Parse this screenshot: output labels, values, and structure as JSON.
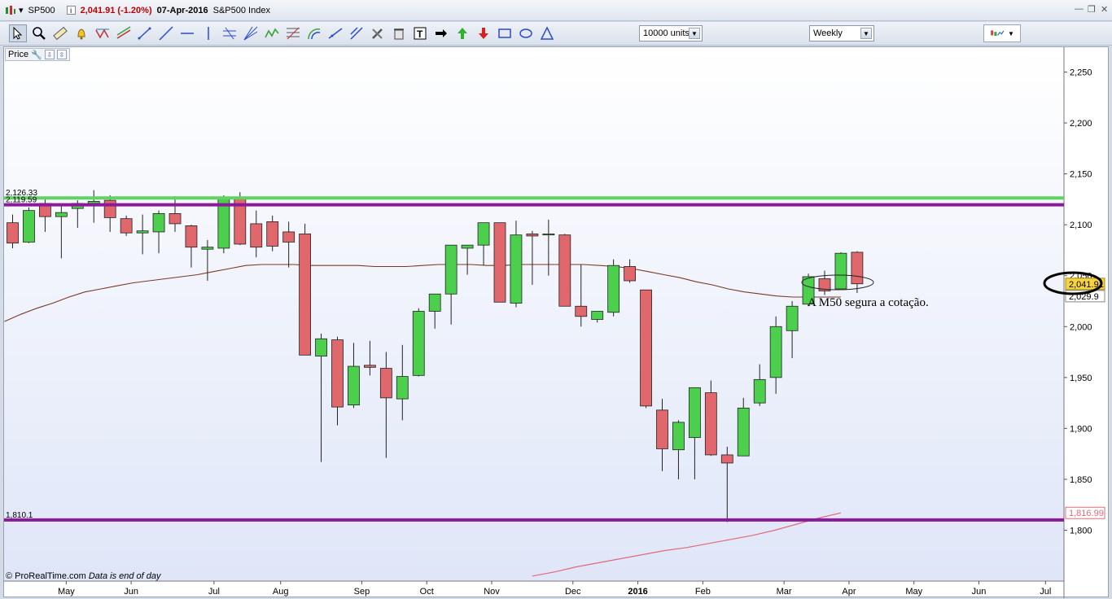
{
  "window": {
    "symbol": "SP500",
    "info_icon": "info-icon",
    "last_change": "2,041.91 (-1.20%)",
    "date": "07-Apr-2016",
    "instrument": "S&P500 Index"
  },
  "toolbar": {
    "units_select": "10000 units",
    "period_select": "Weekly",
    "icons": [
      "pointer-icon",
      "zoom-icon",
      "ruler-icon",
      "alert-bell-icon",
      "triangle-pattern-icon",
      "channel-icon",
      "segment-icon",
      "line-icon",
      "horizontal-line-icon",
      "vertical-line-icon",
      "parallel-lines-icon",
      "fan-icon",
      "zigzag-icon",
      "fibonacci-icon",
      "arc-icon",
      "ray-icon",
      "trend-icon",
      "tools-icon",
      "trash-icon",
      "text-icon",
      "arrow-right-icon",
      "arrow-up-green-icon",
      "arrow-down-red-icon",
      "rectangle-icon",
      "ellipse-icon",
      "triangle-icon"
    ]
  },
  "price_panel": {
    "label": "Price"
  },
  "footer": {
    "copyright": "© ProRealTime.com",
    "note": "Data is end of day"
  },
  "colors": {
    "up": "#4ccf4c",
    "down": "#e0676c",
    "resistance_green": "#5fd45f",
    "resistance_purple": "#8b1a9a",
    "support_purple": "#8b1a9a",
    "ma50": "#7a3a28",
    "ma_long": "#e06a7a",
    "last_price_bg": "#f5d442"
  },
  "chart_data": {
    "type": "candlestick",
    "timeframe": "weekly",
    "ylim": [
      1750,
      2280
    ],
    "y_ticks": [
      "2,250",
      "2,200",
      "2,150",
      "2,100",
      "2,050",
      "2,000",
      "1,950",
      "1,900",
      "1,850",
      "1,800"
    ],
    "x_tick_labels": [
      "May",
      "Jun",
      "Jul",
      "Aug",
      "Sep",
      "Oct",
      "Nov",
      "Dec",
      "2016",
      "Feb",
      "Mar",
      "Apr",
      "May",
      "Jun",
      "Jul"
    ],
    "horizontal_levels": [
      {
        "value": 2126.33,
        "label": "2,126.33",
        "color": "resistance_green"
      },
      {
        "value": 2119.59,
        "label": "2,119.59",
        "color": "resistance_purple"
      },
      {
        "value": 1810.1,
        "label": "1,810.1",
        "color": "support_purple"
      }
    ],
    "price_tags": [
      {
        "value": 2041.91,
        "label": "2,041.91",
        "style": "last"
      },
      {
        "value": 2029.9,
        "label": "2,029.9",
        "style": "ma"
      },
      {
        "value": 1816.99,
        "label": "1,816.99",
        "style": "ma_long"
      }
    ],
    "annotation": "A M50 segura a cotação.",
    "candles": [
      [
        2102,
        2110,
        2077,
        2082
      ],
      [
        2083,
        2117,
        2082,
        2114
      ],
      [
        2121,
        2125,
        2093,
        2108
      ],
      [
        2108,
        2120,
        2067,
        2112
      ],
      [
        2116,
        2124,
        2097,
        2121
      ],
      [
        2121,
        2134,
        2102,
        2123
      ],
      [
        2124,
        2129,
        2093,
        2107
      ],
      [
        2106,
        2109,
        2089,
        2092
      ],
      [
        2092,
        2110,
        2071,
        2094
      ],
      [
        2093,
        2114,
        2072,
        2111
      ],
      [
        2111,
        2128,
        2093,
        2101
      ],
      [
        2099,
        2100,
        2058,
        2078
      ],
      [
        2076,
        2085,
        2045,
        2078
      ],
      [
        2077,
        2129,
        2072,
        2126
      ],
      [
        2126,
        2132,
        2080,
        2081
      ],
      [
        2101,
        2114,
        2068,
        2078
      ],
      [
        2103,
        2109,
        2074,
        2079
      ],
      [
        2093,
        2103,
        2058,
        2083
      ],
      [
        2091,
        2101,
        1972,
        1972
      ],
      [
        1971,
        1993,
        1867,
        1988
      ],
      [
        1987,
        1990,
        1903,
        1921
      ],
      [
        1923,
        1984,
        1920,
        1961
      ],
      [
        1962,
        1986,
        1952,
        1960
      ],
      [
        1959,
        1975,
        1871,
        1930
      ],
      [
        1929,
        1982,
        1908,
        1951
      ],
      [
        1952,
        2018,
        1951,
        2015
      ],
      [
        2015,
        2018,
        1998,
        2032
      ],
      [
        2032,
        2040,
        2002,
        2080
      ],
      [
        2077,
        2080,
        2051,
        2080
      ],
      [
        2080,
        2096,
        2060,
        2102
      ],
      [
        2102,
        2095,
        2035,
        2024
      ],
      [
        2023,
        2104,
        2019,
        2090
      ],
      [
        2091,
        2094,
        2041,
        2089
      ],
      [
        2090,
        2105,
        2050,
        2091
      ],
      [
        2090,
        2091,
        2045,
        2020
      ],
      [
        2020,
        2061,
        2000,
        2010
      ],
      [
        2007,
        2013,
        2004,
        2015
      ],
      [
        2014,
        2066,
        2010,
        2060
      ],
      [
        2059,
        2066,
        2043,
        2045
      ],
      [
        2036,
        2036,
        1920,
        1922
      ],
      [
        1918,
        1929,
        1858,
        1880
      ],
      [
        1879,
        1908,
        1850,
        1906
      ],
      [
        1891,
        1939,
        1850,
        1940
      ],
      [
        1935,
        1947,
        1873,
        1874
      ],
      [
        1874,
        1882,
        1808,
        1866
      ],
      [
        1873,
        1930,
        1873,
        1920
      ],
      [
        1925,
        1963,
        1922,
        1948
      ],
      [
        1950,
        2010,
        1934,
        2000
      ],
      [
        1996,
        2025,
        1969,
        2020
      ],
      [
        2022,
        2052,
        2020,
        2049
      ],
      [
        2047,
        2055,
        2031,
        2035
      ],
      [
        2037,
        2073,
        2037,
        2072
      ],
      [
        2073,
        2074,
        2033,
        2042
      ]
    ],
    "ma50": [
      2005,
      2012,
      2018,
      2023,
      2029,
      2034,
      2037,
      2040,
      2043,
      2045,
      2047,
      2049,
      2051,
      2054,
      2057,
      2060,
      2061,
      2061,
      2061,
      2060,
      2060,
      2060,
      2060,
      2059,
      2059,
      2059,
      2060,
      2061,
      2061,
      2061,
      2060,
      2060,
      2061,
      2061,
      2061,
      2061,
      2061,
      2060,
      2059,
      2057,
      2054,
      2051,
      2048,
      2044,
      2041,
      2037,
      2034,
      2032,
      2030,
      2029,
      2029,
      2029,
      2029
    ],
    "ma_long": [
      1755,
      1759,
      1764,
      1768,
      1772,
      1776,
      1780,
      1783,
      1787,
      1791,
      1795,
      1800,
      1806,
      1812,
      1817
    ]
  }
}
